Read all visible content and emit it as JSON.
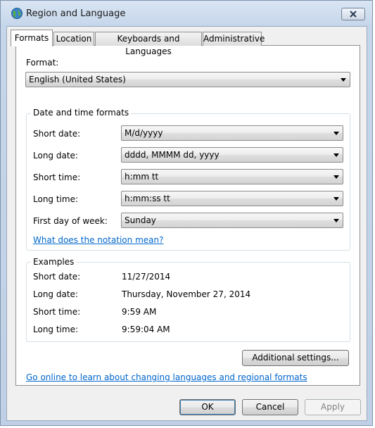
{
  "window": {
    "title": "Region and Language",
    "close_icon": "close-icon"
  },
  "tabs": [
    {
      "label": "Formats",
      "active": true
    },
    {
      "label": "Location",
      "active": false
    },
    {
      "label": "Keyboards and Languages",
      "active": false
    },
    {
      "label": "Administrative",
      "active": false
    }
  ],
  "format": {
    "label": "Format:",
    "selected": "English (United States)"
  },
  "date_time_formats": {
    "title": "Date and time formats",
    "rows": [
      {
        "label": "Short date:",
        "value": "M/d/yyyy"
      },
      {
        "label": "Long date:",
        "value": "dddd, MMMM dd, yyyy"
      },
      {
        "label": "Short time:",
        "value": "h:mm tt"
      },
      {
        "label": "Long time:",
        "value": "h:mm:ss tt"
      },
      {
        "label": "First day of week:",
        "value": "Sunday"
      }
    ],
    "notation_link": "What does the notation mean?"
  },
  "examples": {
    "title": "Examples",
    "rows": [
      {
        "label": "Short date:",
        "value": "11/27/2014"
      },
      {
        "label": "Long date:",
        "value": "Thursday, November 27, 2014"
      },
      {
        "label": "Short time:",
        "value": "9:59 AM"
      },
      {
        "label": "Long time:",
        "value": "9:59:04 AM"
      }
    ]
  },
  "additional_settings_label": "Additional settings...",
  "online_link": "Go online to learn about changing languages and regional formats",
  "buttons": {
    "ok": "OK",
    "cancel": "Cancel",
    "apply": "Apply"
  },
  "colors": {
    "link": "#0066cc",
    "title_bar": "#c6d6ea"
  }
}
